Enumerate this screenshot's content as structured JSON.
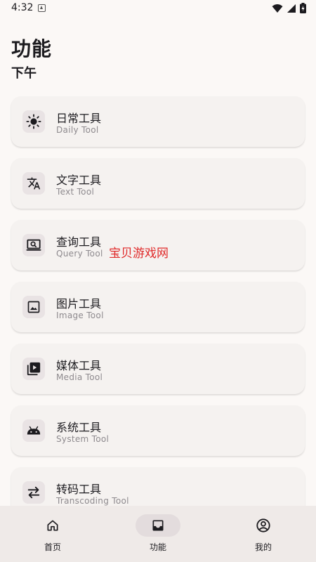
{
  "status_bar": {
    "time": "4:32"
  },
  "header": {
    "title": "功能",
    "subtitle": "下午"
  },
  "tools": [
    {
      "title": "日常工具",
      "subtitle": "Daily Tool",
      "icon": "sun-icon"
    },
    {
      "title": "文字工具",
      "subtitle": "Text Tool",
      "icon": "translate-icon"
    },
    {
      "title": "查询工具",
      "subtitle": "Query Tool",
      "icon": "search-screen-icon"
    },
    {
      "title": "图片工具",
      "subtitle": "Image Tool",
      "icon": "image-icon"
    },
    {
      "title": "媒体工具",
      "subtitle": "Media Tool",
      "icon": "video-library-icon"
    },
    {
      "title": "系统工具",
      "subtitle": "System Tool",
      "icon": "android-icon"
    },
    {
      "title": "转码工具",
      "subtitle": "Transcoding Tool",
      "icon": "swap-icon"
    }
  ],
  "watermark": "宝贝游戏网",
  "bottom_nav": [
    {
      "label": "首页",
      "icon": "home-icon"
    },
    {
      "label": "功能",
      "icon": "inbox-icon",
      "active": true
    },
    {
      "label": "我的",
      "icon": "account-icon"
    }
  ],
  "colors": {
    "background": "#fbf8f6",
    "card": "#f5f2f0",
    "icon_bg": "#e9e3e4",
    "nav_bg": "#efeae8",
    "watermark": "#e02a2a"
  }
}
